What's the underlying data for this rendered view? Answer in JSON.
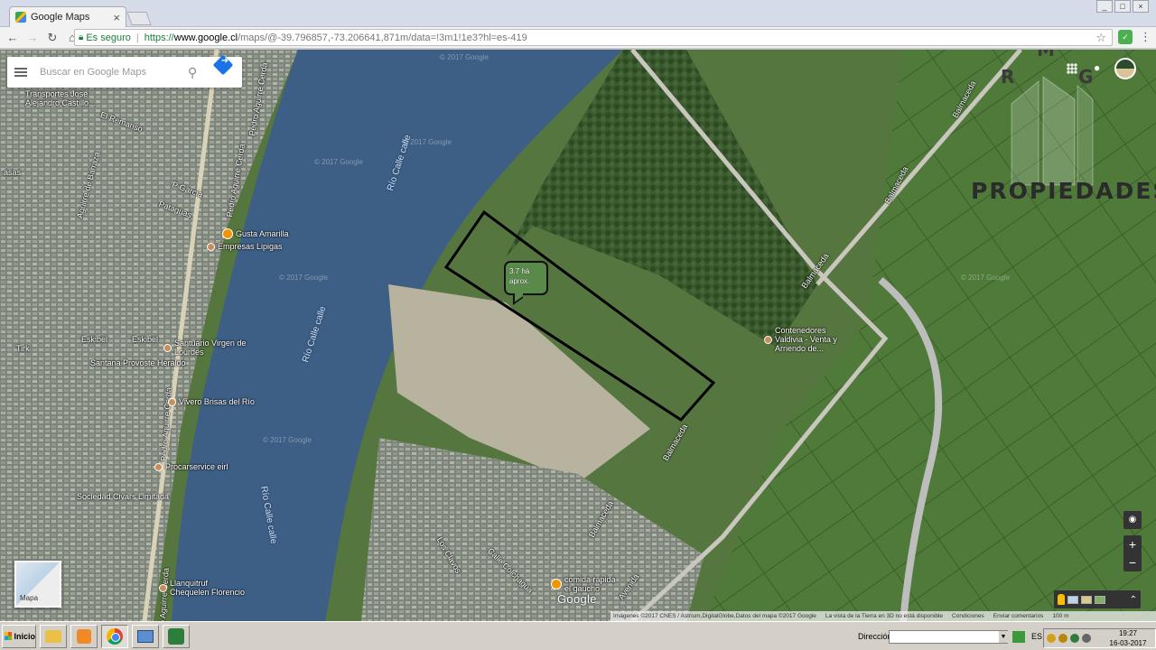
{
  "browser": {
    "tab_title": "Google Maps",
    "tab_close": "×",
    "secure_label": "Es seguro",
    "url_scheme": "https://",
    "url_host": "www.google.cl",
    "url_rest": "/maps/@-39.796857,-73.206641,871m/data=!3m1!1e3?hl=es-419",
    "window_controls": [
      "_",
      "□",
      "×"
    ]
  },
  "search": {
    "placeholder": "Buscar en Google Maps"
  },
  "brand": {
    "letters": [
      "M",
      "R",
      "G"
    ],
    "name": "PROPIEDADES"
  },
  "callout": {
    "line1": "3.7 há",
    "line2": "aprox."
  },
  "map_labels": {
    "rio_1": "Río Calle calle",
    "rio_2": "Río Calle calle",
    "rio_3": "Río Calle calle",
    "balmaceda_1": "Balmaceda",
    "balmaceda_2": "Balmaceda",
    "balmaceda_3": "Balmaceda",
    "balmaceda_4": "Balmaceda",
    "balmaceda_5": "Balmaceda",
    "pedro_1": "Pedro Aguirre Cerda",
    "pedro_2": "Pedro Aguirre Cerda",
    "pedro_3": "Pedro Aguirre Cerda",
    "pedro_4": "Pedro Aguirre Cerda",
    "aguirre_barra": "Aguirre de Barraza",
    "el_remanso": "El Remanso",
    "garcia": "P García",
    "pataguas": "Pataguas",
    "eskibel_1": "Eskibel",
    "eskibel_2": "Eskibel",
    "tirk": "Tirk",
    "basas": "asas",
    "los_clavos": "Los Clavos",
    "calle_colchagua": "Calle Colchagua",
    "avenida": "Avenida"
  },
  "pois": [
    {
      "label": "Transportes José Alejandro Castillo...",
      "type": "normal"
    },
    {
      "label": "Gusta Amarilla",
      "type": "orange"
    },
    {
      "label": "Empresas Lipigas",
      "type": "normal"
    },
    {
      "label": "Santuario Virgen de Lourdes",
      "type": "normal"
    },
    {
      "label": "Santana Provoste Heraldo",
      "type": "none"
    },
    {
      "label": "Vivero Brisas del Río",
      "type": "normal"
    },
    {
      "label": "Procarservice eirl",
      "type": "normal"
    },
    {
      "label": "Sociedad Civars Limitada",
      "type": "normal"
    },
    {
      "label": "Llanquitruf Chequelen Florencio",
      "type": "normal"
    },
    {
      "label": "Contenedores Valdivia - Venta y Arriendo de...",
      "type": "normal"
    },
    {
      "label": "comida rápida el gaucho",
      "type": "orange"
    }
  ],
  "watermarks": [
    "© 2017 Google",
    "© 2017 Google",
    "© 2017 Google",
    "© 2017 Google",
    "© 2017 Google",
    "© 2017 Google"
  ],
  "controls": {
    "minimap_label": "Mapa",
    "zoom_in": "+",
    "zoom_out": "−",
    "compass": "◉",
    "chevron": "⌃",
    "google_logo": "Google"
  },
  "attribution": {
    "imagery": "Imágenes ©2017 CNES / Astrium,DigitalGlobe,Datos del mapa ©2017 Google",
    "earth": "La vista de la Tierra en 3D no está disponible",
    "conditions": "Condiciones",
    "feedback": "Enviar comentarios",
    "scale": "100 m"
  },
  "taskbar": {
    "start_label": "Inicio",
    "address_label": "Dirección",
    "language": "ES",
    "clock_time": "19:27",
    "clock_date": "16-03-2017"
  },
  "colors": {
    "river": "#3d5f86",
    "parcel_stroke": "#000000",
    "brand_overlay": "#ffffff"
  }
}
